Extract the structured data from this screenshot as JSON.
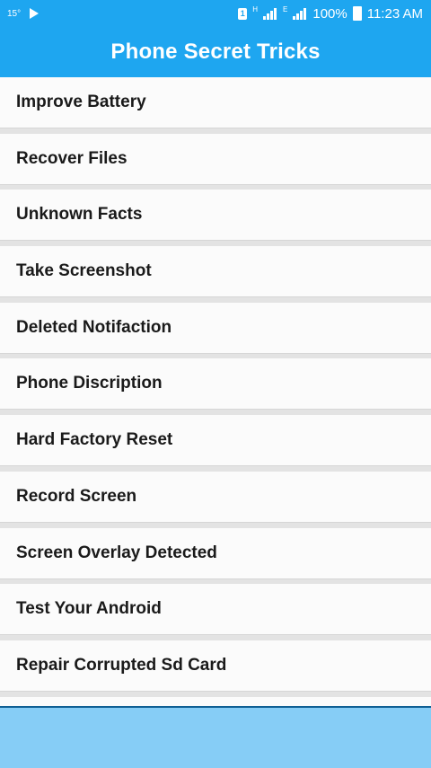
{
  "status_bar": {
    "temperature": "15°",
    "network_h": "H",
    "network_e": "E",
    "battery": "100%",
    "time": "11:23 AM",
    "icons": [
      "play-icon",
      "notification-icon",
      "signal-icon",
      "battery-icon"
    ]
  },
  "header": {
    "title": "Phone Secret Tricks"
  },
  "menu": {
    "items": [
      {
        "label": "Improve Battery"
      },
      {
        "label": "Recover Files"
      },
      {
        "label": "Unknown Facts"
      },
      {
        "label": "Take Screenshot"
      },
      {
        "label": "Deleted Notifaction"
      },
      {
        "label": "Phone Discription"
      },
      {
        "label": "Hard Factory Reset"
      },
      {
        "label": "Record Screen"
      },
      {
        "label": "Screen Overlay Detected"
      },
      {
        "label": "Test Your Android"
      },
      {
        "label": "Repair Corrupted Sd Card"
      },
      {
        "label": ""
      }
    ]
  },
  "colors": {
    "accent": "#1ea6f0",
    "panel": "#86cdf6"
  }
}
